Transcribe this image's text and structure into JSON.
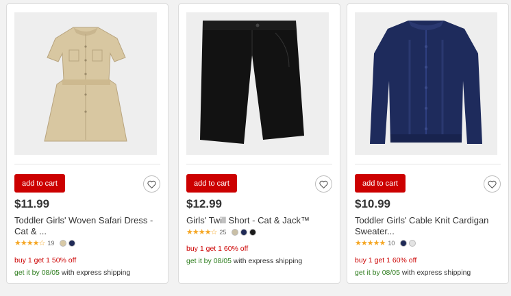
{
  "products": [
    {
      "price": "$11.99",
      "title": "Toddler Girls' Woven Safari Dress - Cat & ...",
      "stars": "★★★★☆",
      "review_count": "19",
      "swatches": [
        "#d8c9a6",
        "#1f2a56"
      ],
      "offer": "buy 1 get 1 50% off",
      "ship_date": "get it by 08/05",
      "ship_method": "with express shipping",
      "add_to_cart": "add to cart",
      "image_icon": "dress-image"
    },
    {
      "price": "$12.99",
      "title": "Girls' Twill Short - Cat & Jack™",
      "stars": "★★★★☆",
      "review_count": "25",
      "swatches": [
        "#c9bfa6",
        "#1f2a56",
        "#1a1a1a"
      ],
      "offer": "buy 1 get 1 60% off",
      "ship_date": "get it by 08/05",
      "ship_method": "with express shipping",
      "add_to_cart": "add to cart",
      "image_icon": "shorts-image"
    },
    {
      "price": "$10.99",
      "title": "Toddler Girls' Cable Knit Cardigan Sweater...",
      "stars": "★★★★★",
      "review_count": "10",
      "swatches": [
        "#1f2a56",
        "#e3e3e3"
      ],
      "offer": "buy 1 get 1 60% off",
      "ship_date": "get it by 08/05",
      "ship_method": "with express shipping",
      "add_to_cart": "add to cart",
      "image_icon": "cardigan-image"
    }
  ],
  "colors": {
    "accent": "#cc0000",
    "ship_green": "#2e7d1e",
    "star": "#f5a623"
  }
}
